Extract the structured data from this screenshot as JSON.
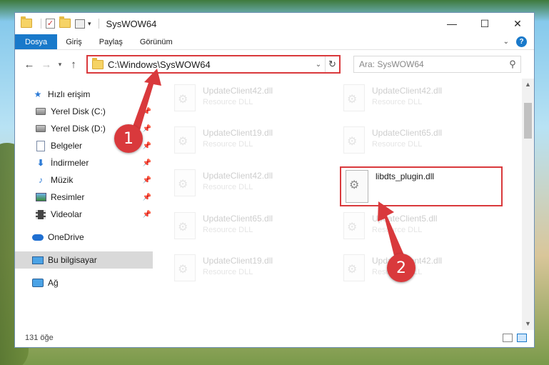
{
  "window": {
    "title": "SysWOW64",
    "controls": {
      "minimize": "—",
      "maximize": "☐",
      "close": "✕"
    }
  },
  "ribbon": {
    "tabs": [
      "Dosya",
      "Giriş",
      "Paylaş",
      "Görünüm"
    ]
  },
  "address": {
    "path": "C:\\Windows\\SysWOW64",
    "search_placeholder": "Ara: SysWOW64"
  },
  "sidebar": {
    "items": [
      {
        "label": "Hızlı erişim",
        "icon": "star-icon"
      },
      {
        "label": "Yerel Disk (C:)",
        "icon": "drive-icon",
        "pinned": true
      },
      {
        "label": "Yerel Disk (D:)",
        "icon": "drive-icon",
        "pinned": true
      },
      {
        "label": "Belgeler",
        "icon": "documents-icon",
        "pinned": true
      },
      {
        "label": "İndirmeler",
        "icon": "downloads-icon",
        "pinned": true
      },
      {
        "label": "Müzik",
        "icon": "music-icon",
        "pinned": true
      },
      {
        "label": "Resimler",
        "icon": "pictures-icon",
        "pinned": true
      },
      {
        "label": "Videolar",
        "icon": "videos-icon",
        "pinned": true
      },
      {
        "label": "OneDrive",
        "icon": "onedrive-icon"
      },
      {
        "label": "Bu bilgisayar",
        "icon": "this-pc-icon",
        "selected": true
      },
      {
        "label": "Ağ",
        "icon": "network-icon"
      }
    ]
  },
  "files": [
    {
      "name": "UpdateClient42.dll",
      "type": "Resource DLL"
    },
    {
      "name": "UpdateClient42.dll",
      "type": "Resource DLL"
    },
    {
      "name": "UpdateClient19.dll",
      "type": "Resource DLL"
    },
    {
      "name": "UpdateClient65.dll",
      "type": "Resource DLL"
    },
    {
      "name": "UpdateClient42.dll",
      "type": "Resource DLL"
    },
    {
      "name": "libdts_plugin.dll",
      "type": ""
    },
    {
      "name": "UpdateClient65.dll",
      "type": "Resource DLL"
    },
    {
      "name": "UpdateClient5.dll",
      "type": "Resource DLL"
    },
    {
      "name": "UpdateClient19.dll",
      "type": "Resource DLL"
    },
    {
      "name": "UpdateClient42.dll",
      "type": "Resource DLL"
    }
  ],
  "status": {
    "item_count": "131 öğe"
  },
  "annotations": {
    "step1": "1",
    "step2": "2"
  },
  "colors": {
    "accent": "#1979ca",
    "highlight": "#d9393c"
  }
}
